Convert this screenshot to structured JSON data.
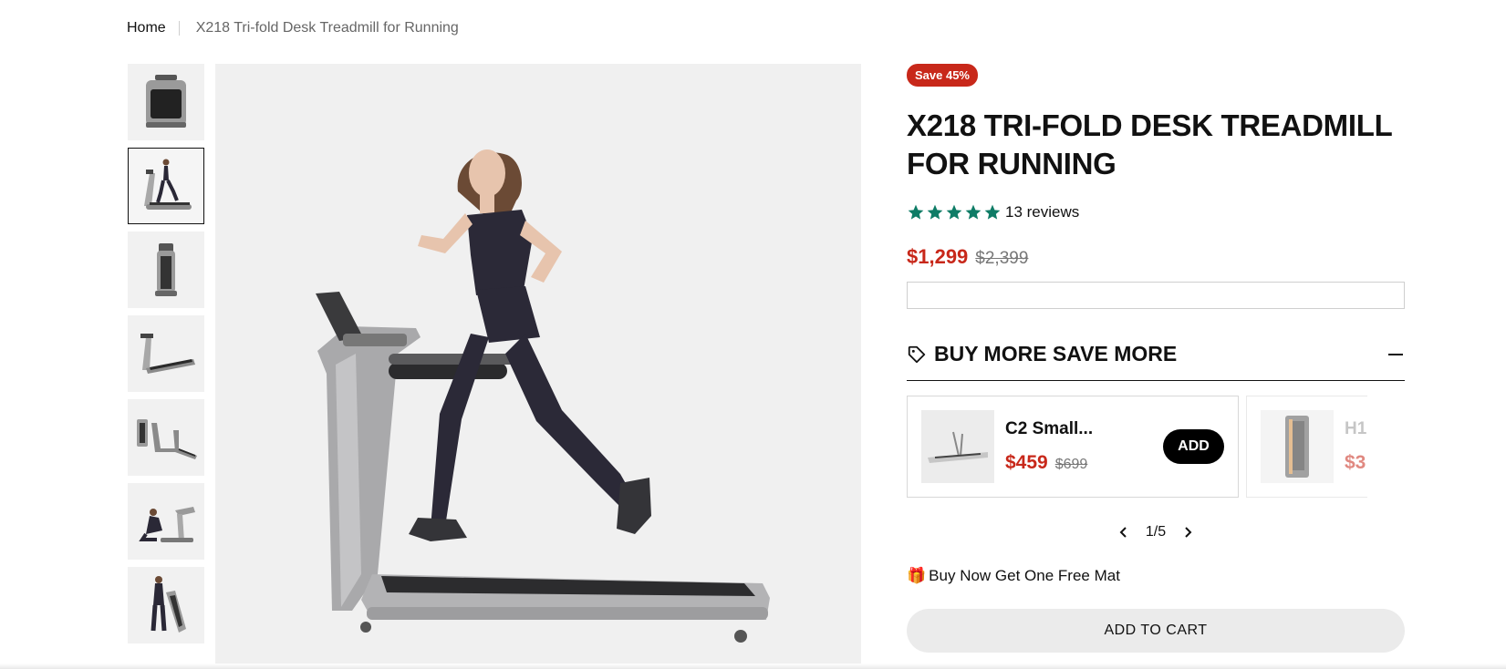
{
  "breadcrumb": {
    "home": "Home",
    "current": "X218 Tri-fold Desk Treadmill for Running"
  },
  "gallery": {
    "thumbnail_count": 7,
    "active_index": 1
  },
  "product": {
    "badge": "Save 45%",
    "title": "X218 TRI-FOLD DESK TREADMILL FOR RUNNING",
    "rating": 5,
    "reviews": "13 reviews",
    "price": "$1,299",
    "compare_price": "$2,399"
  },
  "bundle": {
    "heading": "BUY MORE SAVE MORE",
    "items": [
      {
        "name": "C2 Small...",
        "price": "$459",
        "compare_price": "$699",
        "button": "ADD"
      },
      {
        "name": "H1",
        "price": "$3"
      }
    ],
    "pager": "1/5"
  },
  "promo": {
    "icon": "gift-icon",
    "text": "Buy Now Get One Free Mat"
  },
  "cart": {
    "label": "ADD TO CART"
  },
  "colors": {
    "accent_red": "#c8281a",
    "star_green": "#0e7c66",
    "button_black": "#000000"
  }
}
